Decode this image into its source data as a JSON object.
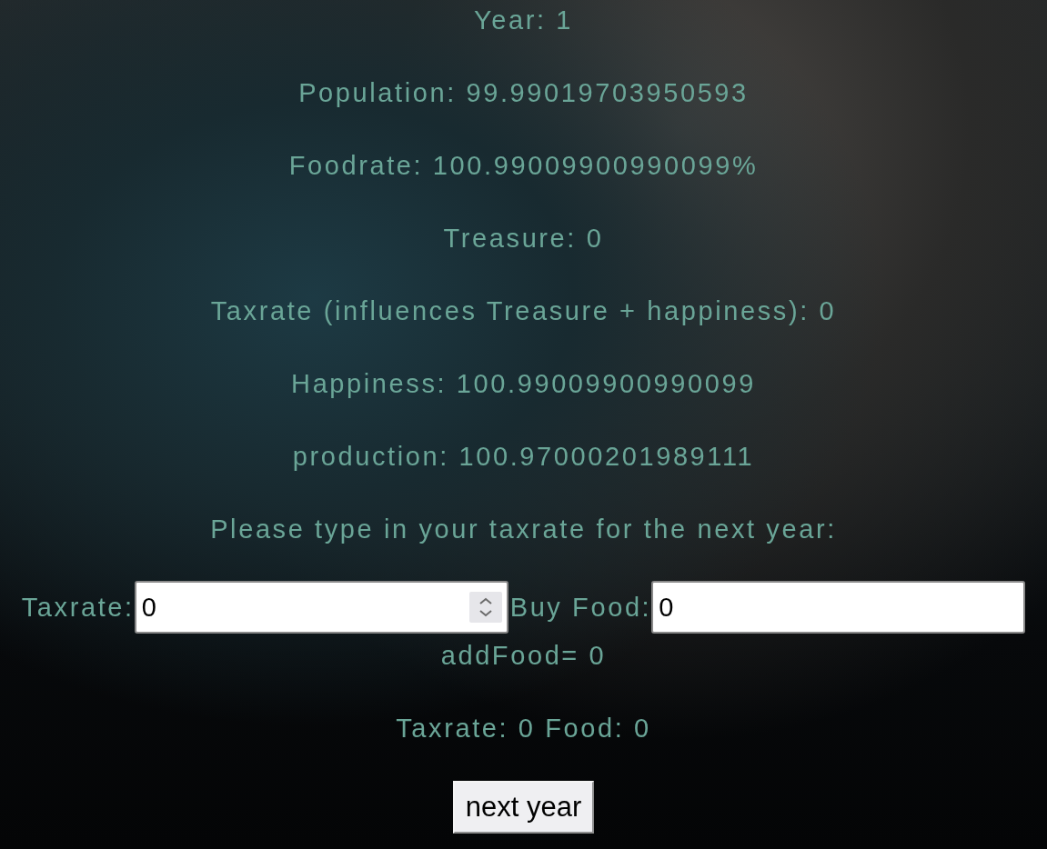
{
  "stats": [
    "Year: 1",
    "Population: 99.99019703950593",
    "Foodrate: 100.99009900990099%",
    "Treasure: 0",
    "Taxrate (influences Treasure + happiness): 0",
    "Happiness: 100.99009900990099",
    "production: 100.97000201989111"
  ],
  "prompt": "Please type in your taxrate for the next year:",
  "inputs": [
    {
      "label": "Taxrate:",
      "value": "0",
      "kind": "number"
    },
    {
      "label": "Buy Food:",
      "value": "0",
      "kind": "text"
    }
  ],
  "add_food": "addFood= 0",
  "summary": "Taxrate: 0 Food: 0",
  "button": "next year"
}
